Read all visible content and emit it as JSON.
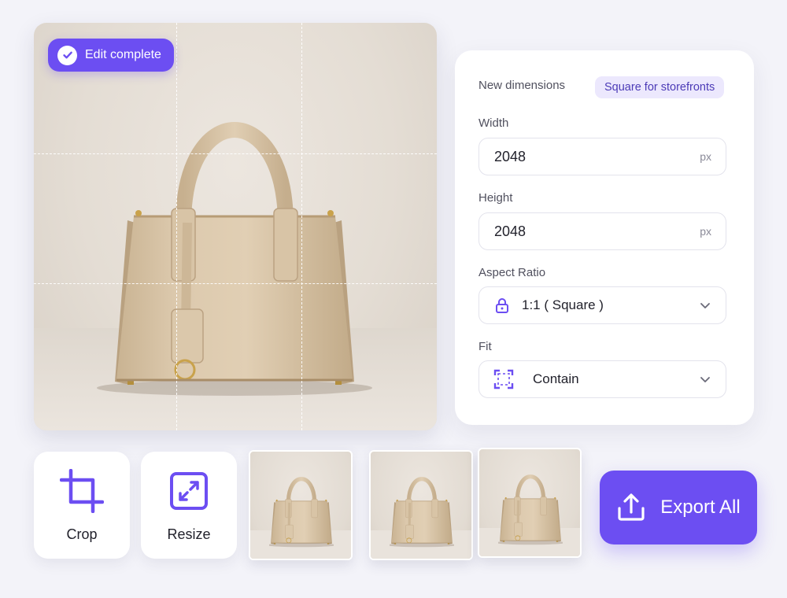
{
  "preview": {
    "badge_label": "Edit complete"
  },
  "panel": {
    "title": "New dimensions",
    "preset_chip": "Square for storefronts",
    "width": {
      "label": "Width",
      "value": "2048",
      "unit": "px"
    },
    "height": {
      "label": "Height",
      "value": "2048",
      "unit": "px"
    },
    "aspect_ratio": {
      "label": "Aspect Ratio",
      "value": "1:1 ( Square )",
      "icon": "lock-icon"
    },
    "fit": {
      "label": "Fit",
      "value": "Contain",
      "icon": "fit-frame-icon"
    }
  },
  "tools": [
    {
      "label": "Crop",
      "icon": "crop-icon"
    },
    {
      "label": "Resize",
      "icon": "resize-icon"
    }
  ],
  "thumbnails": [
    "bag",
    "bag",
    "bag"
  ],
  "export": {
    "label": "Export All",
    "icon": "upload-icon"
  },
  "colors": {
    "accent": "#6c4ef2",
    "chip_bg": "#ece8fd",
    "chip_text": "#4c3bb7",
    "bag": "#d6c3a6",
    "background": "#f3f3f9"
  }
}
